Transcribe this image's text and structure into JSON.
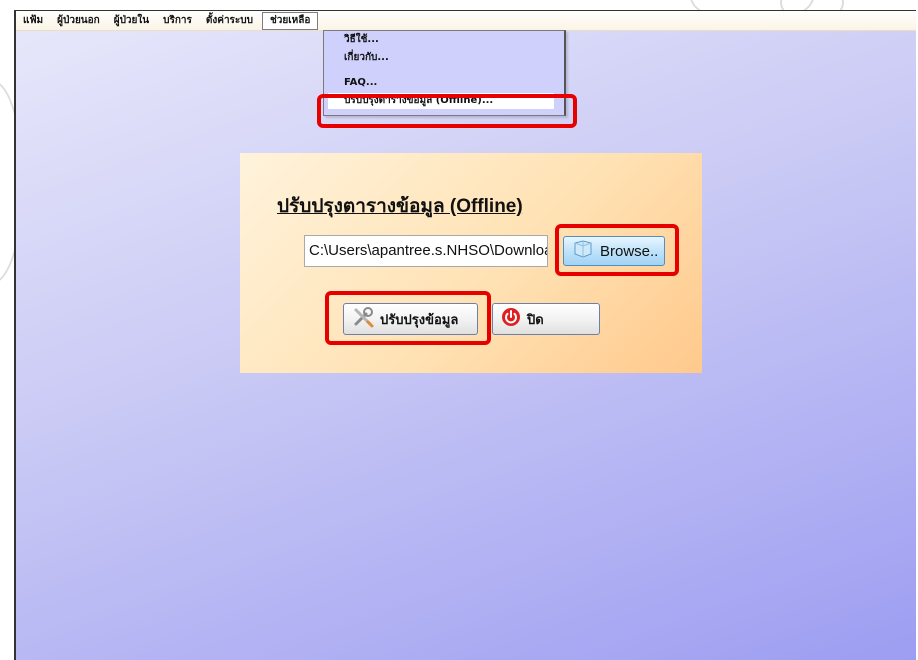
{
  "menubar": {
    "items": [
      {
        "label": "แฟ้ม"
      },
      {
        "label": "ผู้ป่วยนอก"
      },
      {
        "label": "ผู้ป่วยใน"
      },
      {
        "label": "บริการ"
      },
      {
        "label": "ตั้งค่าระบบ"
      },
      {
        "label": "ช่วยเหลือ"
      }
    ]
  },
  "help_menu": {
    "items": [
      {
        "label": "วิธีใช้..."
      },
      {
        "label": "เกี่ยวกับ..."
      },
      {
        "label": "FAQ..."
      },
      {
        "label": "ปรับปรุงตารางข้อมูล (Offline)..."
      }
    ]
  },
  "dialog": {
    "title": "ปรับปรุงตารางข้อมูล (Offline)",
    "path_value": "C:\\Users\\apantree.s.NHSO\\Downloads",
    "browse_label": "Browse..",
    "update_label": "ปรับปรุงข้อมูล",
    "close_label": "ปิด"
  },
  "icons": {
    "browse": "folder-icon",
    "update": "tools-icon",
    "close": "power-icon"
  },
  "colors": {
    "highlight_box": "#e60000",
    "panel_bg": "#ffe2b4",
    "window_bg": "#c9c9f5"
  }
}
